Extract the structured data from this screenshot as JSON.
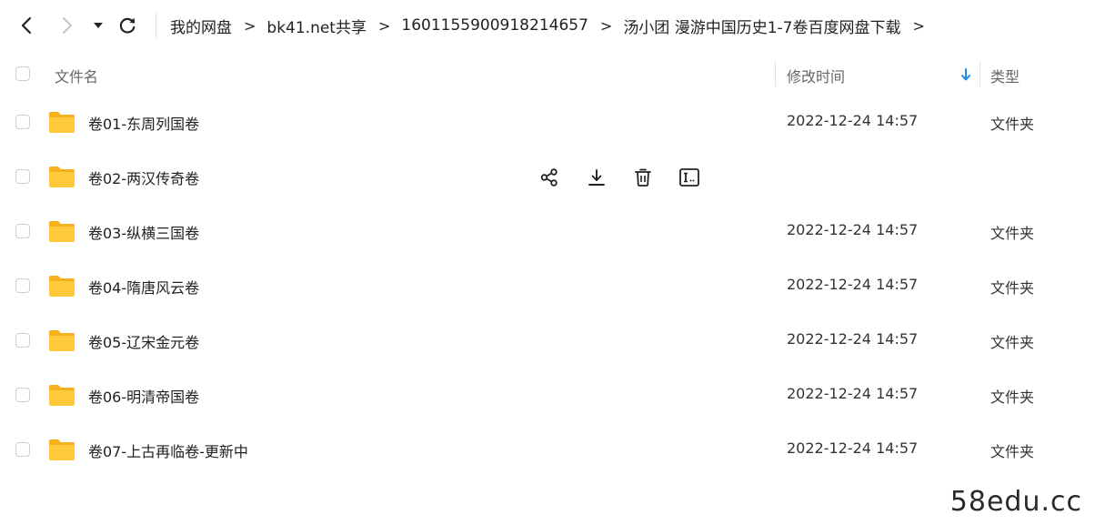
{
  "breadcrumb": [
    {
      "label": "我的网盘"
    },
    {
      "label": "bk41.net共享"
    },
    {
      "label": "1601155900918214657"
    },
    {
      "label": "汤小团 漫游中国历史1-7卷百度网盘下载"
    }
  ],
  "breadcrumb_separator": ">",
  "header": {
    "name_label": "文件名",
    "time_label": "修改时间",
    "type_label": "类型"
  },
  "files": [
    {
      "name": "卷01-东周列国卷",
      "modified": "2022-12-24 14:57",
      "type": "文件夹"
    },
    {
      "name": "卷02-两汉传奇卷",
      "modified": "",
      "type": "",
      "hovered": true
    },
    {
      "name": "卷03-纵横三国卷",
      "modified": "2022-12-24 14:57",
      "type": "文件夹"
    },
    {
      "name": "卷04-隋唐风云卷",
      "modified": "2022-12-24 14:57",
      "type": "文件夹"
    },
    {
      "name": "卷05-辽宋金元卷",
      "modified": "2022-12-24 14:57",
      "type": "文件夹"
    },
    {
      "name": "卷06-明清帝国卷",
      "modified": "2022-12-24 14:57",
      "type": "文件夹"
    },
    {
      "name": "卷07-上古再临卷-更新中",
      "modified": "2022-12-24 14:57",
      "type": "文件夹"
    }
  ],
  "row_actions": [
    "share-icon",
    "download-icon",
    "delete-icon",
    "rename-icon"
  ],
  "watermark": "58edu.cc",
  "colors": {
    "folder": "#FFC93C",
    "folder_tab": "#F5B21E",
    "sort_arrow": "#1E88E5",
    "text": "#1f1f1f",
    "muted": "#666666"
  }
}
